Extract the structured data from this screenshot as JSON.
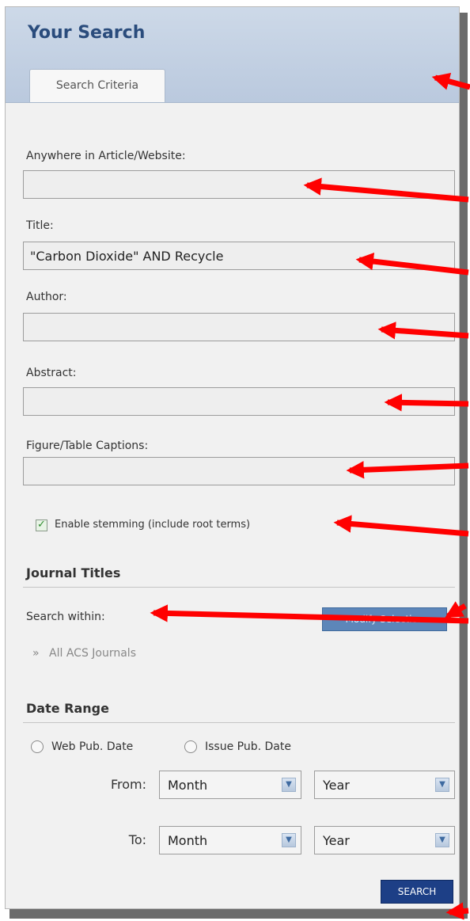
{
  "panel": {
    "title": "Your Search",
    "tab_label": "Search Criteria"
  },
  "fields": [
    {
      "label": "Anywhere in Article/Website:",
      "value": ""
    },
    {
      "label": "Title:",
      "value": "\"Carbon Dioxide\" AND Recycle"
    },
    {
      "label": "Author:",
      "value": ""
    },
    {
      "label": "Abstract:",
      "value": ""
    },
    {
      "label": "Figure/Table Captions:",
      "value": ""
    }
  ],
  "stemming": {
    "label": "Enable stemming (include root terms)",
    "checked": true
  },
  "journals": {
    "heading": "Journal Titles",
    "search_within_label": "Search within:",
    "modify_button": "Modify Selection",
    "selected": "All ACS Journals",
    "bullet": "»"
  },
  "date_range": {
    "heading": "Date Range",
    "options": [
      "Web Pub. Date",
      "Issue Pub. Date"
    ],
    "from_label": "From:",
    "to_label": "To:",
    "month_placeholder": "Month",
    "year_placeholder": "Year"
  },
  "search_button": "SEARCH",
  "colors": {
    "annotation_arrow": "#ff0000",
    "title": "#2a4c7c",
    "search_button": "#1d3f86",
    "modify_button": "#5d86b9"
  }
}
